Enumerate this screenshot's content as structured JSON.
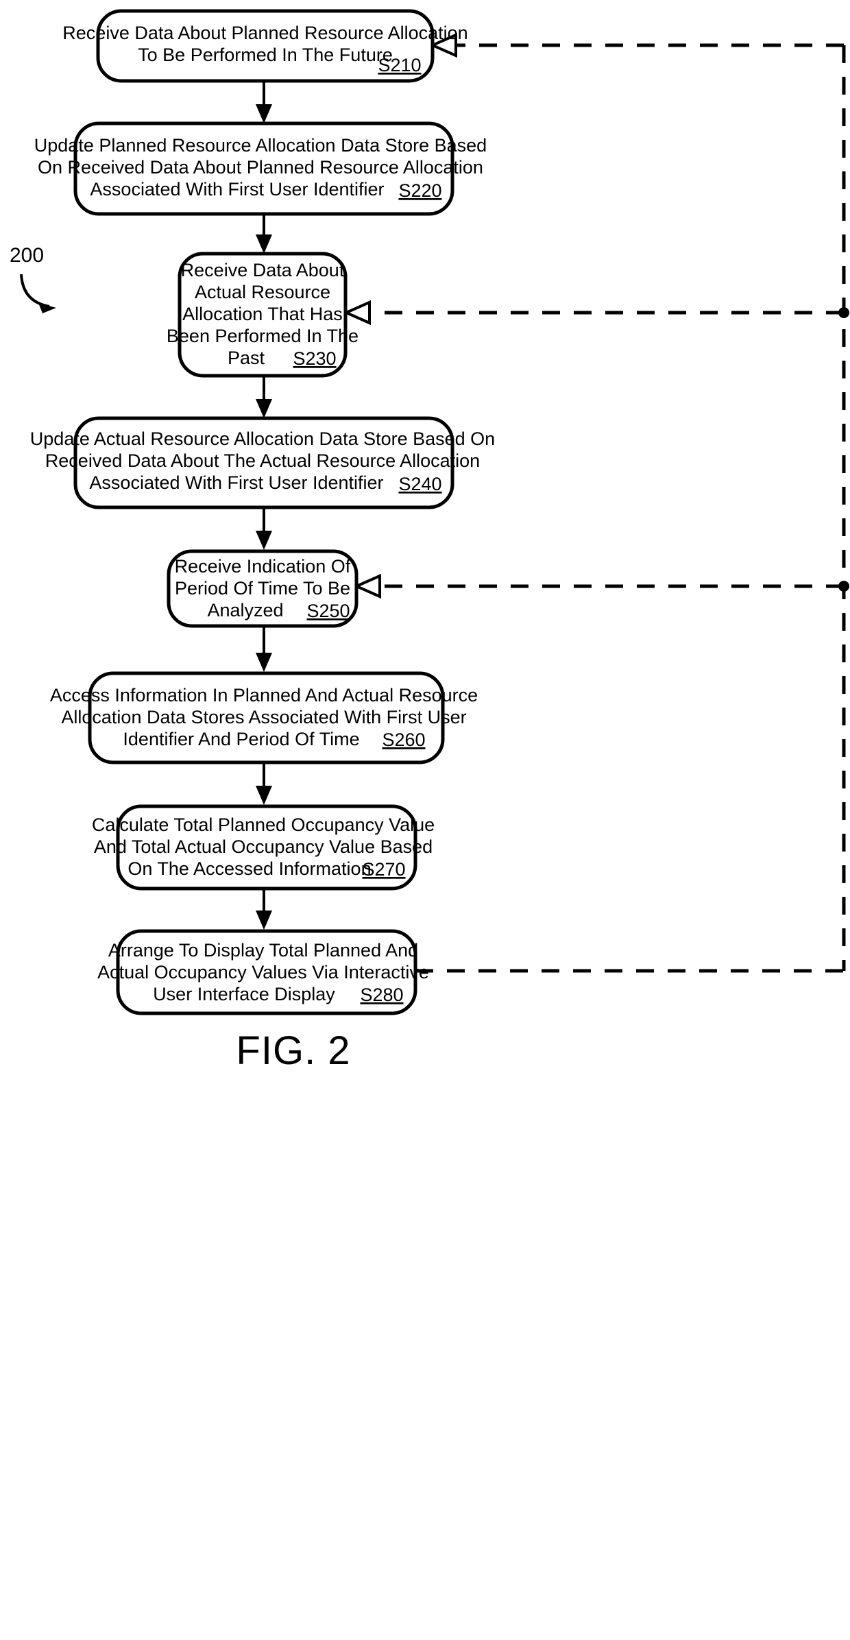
{
  "figure": {
    "caption": "FIG. 2",
    "reference_numeral": "200",
    "background_color": "#ffffff",
    "line_color": "#000000"
  },
  "nodes": [
    {
      "id": "S210",
      "step_label": "S210",
      "lines": [
        "Receive Data About Planned Resource Allocation",
        "To Be Performed In The Future"
      ],
      "line1": "Receive Data About Planned Resource Allocation",
      "line2": "To Be Performed In The Future",
      "line3": "",
      "line4": "",
      "line5": ""
    },
    {
      "id": "S220",
      "step_label": "S220",
      "lines": [
        "Update Planned Resource Allocation Data Store Based",
        "On Received Data About Planned Resource Allocation",
        "Associated With First User Identifier"
      ],
      "line1": "Update Planned Resource Allocation Data Store Based",
      "line2": "On Received Data About Planned Resource Allocation",
      "line3": "Associated With First User Identifier",
      "line4": "",
      "line5": ""
    },
    {
      "id": "S230",
      "step_label": "S230",
      "lines": [
        "Receive Data About",
        "Actual Resource",
        "Allocation That Has",
        "Been Performed In The",
        "Past"
      ],
      "line1": "Receive Data About",
      "line2": "Actual Resource",
      "line3": "Allocation That Has",
      "line4": "Been Performed In The",
      "line5": "Past"
    },
    {
      "id": "S240",
      "step_label": "S240",
      "lines": [
        "Update Actual Resource Allocation Data Store Based On",
        "Received Data About The Actual Resource Allocation",
        "Associated With First User Identifier"
      ],
      "line1": "Update Actual Resource Allocation Data Store Based On",
      "line2": "Received Data About The Actual Resource Allocation",
      "line3": "Associated With First User Identifier",
      "line4": "",
      "line5": ""
    },
    {
      "id": "S250",
      "step_label": "S250",
      "lines": [
        "Receive Indication Of",
        "Period Of Time To Be",
        "Analyzed"
      ],
      "line1": "Receive Indication Of",
      "line2": "Period Of Time To Be",
      "line3": "Analyzed",
      "line4": "",
      "line5": ""
    },
    {
      "id": "S260",
      "step_label": "S260",
      "lines": [
        "Access Information In Planned And Actual Resource",
        "Allocation Data Stores Associated With First User",
        "Identifier And Period Of Time"
      ],
      "line1": "Access Information In Planned And Actual Resource",
      "line2": "Allocation Data Stores Associated With First User",
      "line3": "Identifier And Period Of Time",
      "line4": "",
      "line5": ""
    },
    {
      "id": "S270",
      "step_label": "S270",
      "lines": [
        "Calculate Total Planned Occupancy Value",
        "And Total Actual Occupancy Value Based",
        "On The Accessed Information"
      ],
      "line1": "Calculate Total Planned Occupancy Value",
      "line2": "And Total Actual Occupancy Value Based",
      "line3": "On The Accessed Information",
      "line4": "",
      "line5": ""
    },
    {
      "id": "S280",
      "step_label": "S280",
      "lines": [
        "Arrange To Display Total Planned And",
        "Actual Occupancy Values Via Interactive",
        "User Interface Display"
      ],
      "line1": "Arrange To Display Total Planned And",
      "line2": "Actual Occupancy Values Via Interactive",
      "line3": "User Interface Display",
      "line4": "",
      "line5": ""
    }
  ]
}
